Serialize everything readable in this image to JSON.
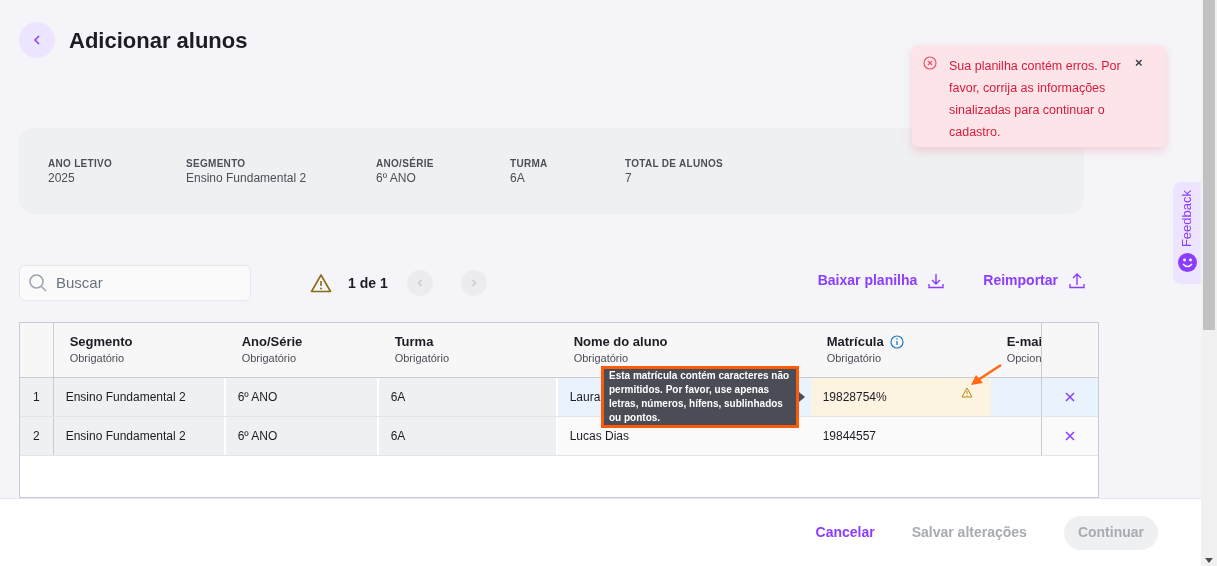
{
  "header": {
    "title": "Adicionar alunos"
  },
  "toast": {
    "message": "Sua planilha contém erros. Por favor, corrija as informações sinalizadas para continuar o cadastro.",
    "close": "×"
  },
  "summary": [
    {
      "label": "ANO LETIVO",
      "value": "2025"
    },
    {
      "label": "SEGMENTO",
      "value": "Ensino Fundamental 2"
    },
    {
      "label": "ANO/SÉRIE",
      "value": "6º ANO"
    },
    {
      "label": "TURMA",
      "value": "6A"
    },
    {
      "label": "TOTAL DE ALUNOS",
      "value": "7"
    }
  ],
  "toolbar": {
    "search_placeholder": "Buscar",
    "pagination": "1 de 1",
    "actions": [
      {
        "label": "Baixar planilha",
        "kind": "download"
      },
      {
        "label": "Reimportar",
        "kind": "upload"
      }
    ]
  },
  "table": {
    "columns": [
      {
        "label": "Segmento",
        "sublabel": "Obrigatório",
        "locked": true
      },
      {
        "label": "Ano/Série",
        "sublabel": "Obrigatório",
        "locked": true
      },
      {
        "label": "Turma",
        "sublabel": "Obrigatório",
        "locked": true
      },
      {
        "label": "Nome do aluno",
        "sublabel": "Obrigatório",
        "locked": false
      },
      {
        "label": "Matrícula",
        "sublabel": "Obrigatório",
        "locked": false,
        "info": true
      },
      {
        "label": "E-mai",
        "sublabel": "Opcion"
      }
    ],
    "rows": [
      {
        "index": "1",
        "selected": true,
        "error": true,
        "cells": [
          "Ensino Fundamental 2",
          "6º ANO",
          "6A",
          "Laura",
          "19828754%"
        ]
      },
      {
        "index": "2",
        "selected": false,
        "error": false,
        "cells": [
          "Ensino Fundamental 2",
          "6º ANO",
          "6A",
          "Lucas Dias",
          "19844557"
        ]
      }
    ],
    "tooltip": "Esta matrícula contém caracteres não permitidos. Por favor, use apenas letras, números, hífens, sublinhados ou pontos."
  },
  "footer": {
    "buttons": [
      {
        "label": "Cancelar",
        "kind": "text",
        "disabled": false
      },
      {
        "label": "Salvar alterações",
        "kind": "text",
        "disabled": true
      },
      {
        "label": "Continuar",
        "kind": "filled",
        "disabled": true
      }
    ]
  },
  "feedback": {
    "label": "Feedback"
  }
}
